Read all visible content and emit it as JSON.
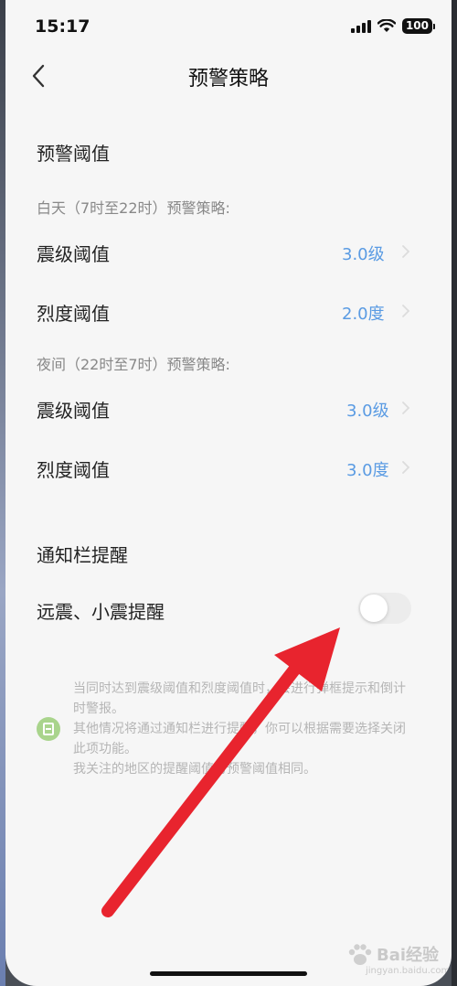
{
  "status_bar": {
    "time": "15:17",
    "battery": "100"
  },
  "nav": {
    "title": "预警策略"
  },
  "threshold_section": {
    "title": "预警阈值",
    "day_label": "白天（7时至22时）预警策略:",
    "day_rows": [
      {
        "label": "震级阈值",
        "value": "3.0级"
      },
      {
        "label": "烈度阈值",
        "value": "2.0度"
      }
    ],
    "night_label": "夜间（22时至7时）预警策略:",
    "night_rows": [
      {
        "label": "震级阈值",
        "value": "3.0级"
      },
      {
        "label": "烈度阈值",
        "value": "3.0度"
      }
    ]
  },
  "notify_section": {
    "title": "通知栏提醒",
    "toggle_label": "远震、小震提醒",
    "toggle_on": false
  },
  "info": {
    "line1": "当同时达到震级阈值和烈度阈值时，会进行弹框提示和倒计时警报。",
    "line2": "其他情况将通过通知栏进行提醒，你可以根据需要选择关闭此项功能。",
    "line3": "我关注的地区的提醒阈值与预警阈值相同。"
  },
  "watermark": {
    "text": "Bai经验",
    "url": "jingyan.baidu.com"
  },
  "colors": {
    "value_blue": "#5a9be3",
    "annotation_arrow": "#e8242e",
    "info_icon_green": "#a9d48c"
  },
  "icons": [
    "chevron-left-icon",
    "chevron-right-icon",
    "signal-icon",
    "wifi-icon",
    "battery-icon",
    "info-note-icon",
    "paw-icon"
  ]
}
